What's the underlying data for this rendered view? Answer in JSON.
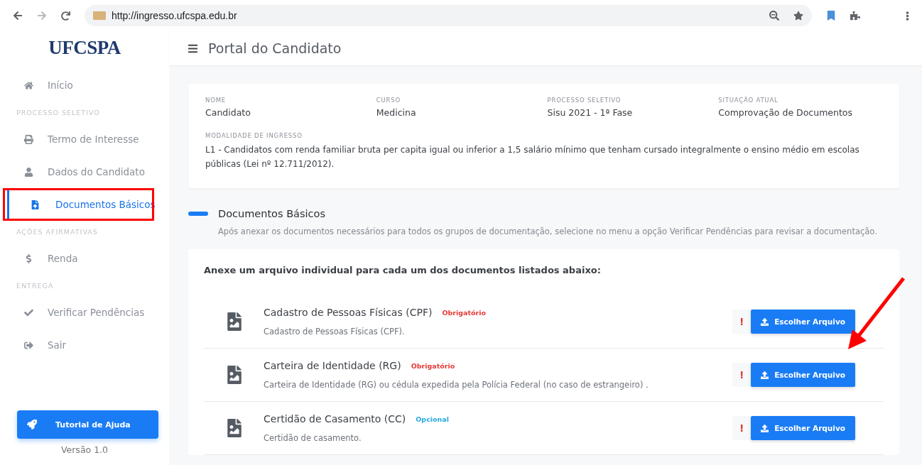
{
  "browser": {
    "url": "http://ingresso.ufcspa.edu.br"
  },
  "sidebar": {
    "logo": "UFCSPA",
    "items": [
      {
        "kind": "link",
        "label": "Início",
        "selected": false
      },
      {
        "kind": "section",
        "label": "PROCESSO SELETIVO"
      },
      {
        "kind": "link",
        "label": "Termo de Interesse",
        "selected": false
      },
      {
        "kind": "link",
        "label": "Dados do Candidato",
        "selected": false
      },
      {
        "kind": "link",
        "label": "Documentos Básicos",
        "selected": true
      },
      {
        "kind": "section",
        "label": "AÇÕES AFIRMATIVAS"
      },
      {
        "kind": "link",
        "label": "Renda",
        "selected": false
      },
      {
        "kind": "section",
        "label": "ENTREGA"
      },
      {
        "kind": "link",
        "label": "Verificar Pendências",
        "selected": false
      },
      {
        "kind": "link",
        "label": "Sair",
        "selected": false
      }
    ],
    "help_button": "Tutorial de Ajuda",
    "version": "Versão 1.0"
  },
  "header": {
    "title": "Portal do Candidato"
  },
  "info": {
    "fields": [
      {
        "label": "NOME",
        "value": "Candidato"
      },
      {
        "label": "CURSO",
        "value": "Medicina"
      },
      {
        "label": "PROCESSO SELETIVO",
        "value": "Sisu 2021 - 1ª Fase"
      },
      {
        "label": "SITUAÇÃO ATUAL",
        "value": "Comprovação de Documentos"
      }
    ],
    "modality_label": "MODALIDADE DE INGRESSO",
    "modality": "L1 - Candidatos com renda familiar bruta per capita igual ou inferior a 1,5 salário mínimo que tenham cursado integralmente o ensino médio em escolas públicas (Lei nº 12.711/2012)."
  },
  "section": {
    "title": "Documentos Básicos",
    "description": "Após anexar os documentos necessários para todos os grupos de documentação, selecione no menu a opção Verificar Pendências para revisar a documentação."
  },
  "documents": {
    "intro": "Anexe um arquivo individual para cada um dos documentos listados abaixo:",
    "items": [
      {
        "title": "Cadastro de Pessoas Físicas (CPF)",
        "badge": {
          "kind": "required",
          "text": "Obrigatório"
        },
        "description": "Cadastro de Pessoas Físicas (CPF).",
        "status": "!",
        "button": "Escolher Arquivo"
      },
      {
        "title": "Carteira de Identidade (RG)",
        "badge": {
          "kind": "required",
          "text": "Obrigatório"
        },
        "description": "Carteira de Identidade (RG) ou cédula expedida pela Polícia Federal (no caso de estrangeiro) .",
        "status": "!",
        "button": "Escolher Arquivo"
      },
      {
        "title": "Certidão de Casamento (CC)",
        "badge": {
          "kind": "optional",
          "text": "Opcional"
        },
        "description": "Certidão de casamento.",
        "status": "!",
        "button": "Escolher Arquivo"
      }
    ]
  }
}
